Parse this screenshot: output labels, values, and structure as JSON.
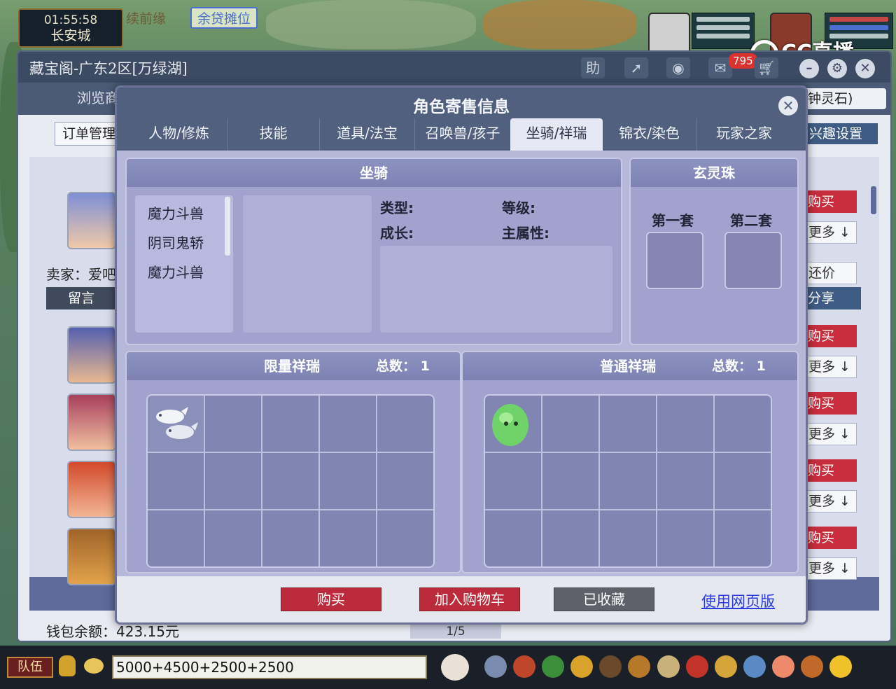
{
  "hud": {
    "time": "01:55:58",
    "city": "长安城",
    "top_text_1": "续前缘",
    "top_text_2": "余贷摊位"
  },
  "stream_logo": "CC直播",
  "outer_window": {
    "title": "藏宝阁-广东2区[万绿湖]",
    "title_help": "助",
    "badge_count": "795",
    "nav_browse": "浏览商",
    "nav_search_text": "钟灵石)",
    "order_btn": "订单管理",
    "interest_btn": "兴趣设置",
    "seller_label": "卖家：爱吧",
    "message_btn": "留言",
    "side_buttons": {
      "buy": "购买",
      "more": "更多",
      "bargain": "还价",
      "share": "分享"
    },
    "wallet": "钱包余额：423.15元",
    "pager": "1/5"
  },
  "modal": {
    "title": "角色寄售信息",
    "close_icon": "close-icon",
    "tabs": [
      "人物/修炼",
      "技能",
      "道具/法宝",
      "召唤兽/孩子",
      "坐骑/祥瑞",
      "锦衣/染色",
      "玩家之家"
    ],
    "active_tab": "坐骑/祥瑞",
    "mount_panel": {
      "title": "坐骑",
      "list": [
        "魔力斗兽",
        "阴司鬼轿",
        "魔力斗兽"
      ],
      "labels": {
        "type": "类型:",
        "level": "等级:",
        "growth": "成长:",
        "main_attr": "主属性:"
      }
    },
    "orb_panel": {
      "title": "玄灵珠",
      "set1": "第一套",
      "set2": "第二套"
    },
    "limited_panel": {
      "title": "限量祥瑞",
      "count_label": "总数：",
      "count": "1",
      "item_icon": "white-dolphins-icon"
    },
    "normal_panel": {
      "title": "普通祥瑞",
      "count_label": "总数：",
      "count": "1",
      "item_icon": "green-blob-pet-icon"
    },
    "footer": {
      "buy": "购买",
      "add_cart": "加入购物车",
      "favorited": "已收藏",
      "web_link": "使用网页版"
    }
  },
  "chat_bar": {
    "team": "队伍",
    "input_value": "5000+4500+2500+2500"
  },
  "colors": {
    "modal_header": "#51607e",
    "panel": "#9fa3cd",
    "buy_red": "#bb2b3b",
    "link_blue": "#2c3ce0"
  }
}
